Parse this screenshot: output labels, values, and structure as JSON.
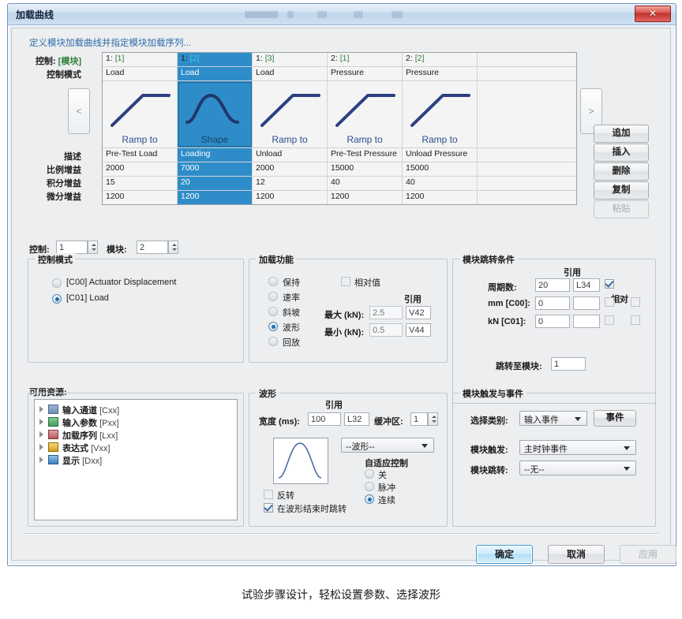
{
  "window": {
    "title": "加载曲线",
    "close_label": "✕",
    "subtitle": "定义模块加载曲线并指定模块加载序列..."
  },
  "sequence_table": {
    "row_labels": {
      "control": "控制:",
      "control_bracket": "[模块]",
      "control_mode": "控制模式",
      "description": "描述",
      "prop_gain": "比例增益",
      "int_gain": "积分增益",
      "diff_gain": "微分增益"
    },
    "prev_arrow": "<",
    "next_arrow": ">",
    "columns": [
      {
        "header_num": "1:",
        "header_idx": "[1]",
        "mode": "Load",
        "shape": "ramp",
        "shape_caption": "Ramp to",
        "description": "Pre-Test Load",
        "prop_gain": "2000",
        "int_gain": "15",
        "diff_gain": "1200",
        "selected": false
      },
      {
        "header_num": "1:",
        "header_idx": "[2]",
        "mode": "Load",
        "shape": "sine",
        "shape_caption": "Shape",
        "description": "Loading",
        "prop_gain": "7000",
        "int_gain": "20",
        "diff_gain": "1200",
        "selected": true
      },
      {
        "header_num": "1:",
        "header_idx": "[3]",
        "mode": "Load",
        "shape": "ramp",
        "shape_caption": "Ramp to",
        "description": "Unload",
        "prop_gain": "2000",
        "int_gain": "12",
        "diff_gain": "1200",
        "selected": false
      },
      {
        "header_num": "2:",
        "header_idx": "[1]",
        "mode": "Pressure",
        "shape": "ramp",
        "shape_caption": "Ramp to",
        "description": "Pre-Test Pressure",
        "prop_gain": "15000",
        "int_gain": "40",
        "diff_gain": "1200",
        "selected": false
      },
      {
        "header_num": "2:",
        "header_idx": "[2]",
        "mode": "Pressure",
        "shape": "ramp",
        "shape_caption": "Ramp to",
        "description": "Unload Pressure",
        "prop_gain": "15000",
        "int_gain": "40",
        "diff_gain": "1200",
        "selected": false
      },
      {
        "header_num": "",
        "header_idx": "",
        "mode": "",
        "shape": "none",
        "shape_caption": "",
        "description": "",
        "prop_gain": "",
        "int_gain": "",
        "diff_gain": "",
        "selected": false
      }
    ]
  },
  "side_buttons": [
    {
      "label": "追加",
      "enabled": true
    },
    {
      "label": "插入",
      "enabled": true
    },
    {
      "label": "删除",
      "enabled": true
    },
    {
      "label": "复制",
      "enabled": true
    },
    {
      "label": "粘贴",
      "enabled": false
    }
  ],
  "selectors": {
    "control_label": "控制:",
    "control_value": "1",
    "module_label": "模块:",
    "module_value": "2"
  },
  "control_mode": {
    "legend": "控制模式",
    "options": [
      {
        "label": "[C00] Actuator Displacement",
        "selected": false
      },
      {
        "label": "[C01] Load",
        "selected": true
      }
    ]
  },
  "load_function": {
    "legend": "加载功能",
    "options": [
      {
        "label": "保持",
        "selected": false
      },
      {
        "label": "速率",
        "selected": false
      },
      {
        "label": "斜坡",
        "selected": false
      },
      {
        "label": "波形",
        "selected": true
      },
      {
        "label": "回放",
        "selected": false
      }
    ],
    "relative_checkbox": {
      "label": "相对值",
      "checked": false
    },
    "reference_header": "引用",
    "max_label": "最大 (kN):",
    "max_value": "2.5",
    "max_ref": "V42",
    "min_label": "最小 (kN):",
    "min_value": "0.5",
    "min_ref": "V44"
  },
  "jump_conditions": {
    "legend": "模块跳转条件",
    "reference_header": "引用",
    "relative_header": "相对",
    "rows": [
      {
        "label": "周期数:",
        "value": "20",
        "ref": "L34",
        "ref_checked": true,
        "rel_checked": false,
        "enabled": true
      },
      {
        "label": "mm [C00]:",
        "value": "0",
        "ref": "",
        "ref_checked": false,
        "rel_checked": false,
        "enabled": false
      },
      {
        "label": "kN [C01]:",
        "value": "0",
        "ref": "",
        "ref_checked": false,
        "rel_checked": false,
        "enabled": false
      }
    ],
    "jump_to_label": "跳转至模块:",
    "jump_to_value": "1"
  },
  "resources": {
    "label": "可用资源:",
    "items": [
      {
        "name": "输入通道",
        "code": "[Cxx]",
        "icon": "channel-icon",
        "color": "#6c8fb5"
      },
      {
        "name": "输入参数",
        "code": "[Pxx]",
        "icon": "parameter-icon",
        "color": "#3f9e5a"
      },
      {
        "name": "加载序列",
        "code": "[Lxx]",
        "icon": "sequence-icon",
        "color": "#b5575e"
      },
      {
        "name": "表达式",
        "code": "[Vxx]",
        "icon": "expression-icon",
        "color": "#d4a017"
      },
      {
        "name": "显示",
        "code": "[Dxx]",
        "icon": "display-icon",
        "color": "#3f7fc1"
      }
    ]
  },
  "waveform": {
    "legend": "波形",
    "reference_header": "引用",
    "width_label": "宽度 (ms):",
    "width_value": "100",
    "width_ref": "L32",
    "buffer_label": "缓冲区:",
    "buffer_value": "1",
    "shape_select": "--波形--",
    "adaptive_legend": "自适应控制",
    "adaptive_options": [
      {
        "label": "关",
        "selected": false
      },
      {
        "label": "脉冲",
        "selected": false
      },
      {
        "label": "连续",
        "selected": true
      }
    ],
    "invert_checkbox": {
      "label": "反转",
      "checked": false
    },
    "jump_at_end_checkbox": {
      "label": "在波形结束时跳转",
      "checked": true
    }
  },
  "triggers": {
    "legend": "模块触发与事件",
    "category_label": "选择类别:",
    "category_value": "输入事件",
    "event_button": "事件",
    "module_trigger_label": "模块触发:",
    "module_trigger_value": "主时钟事件",
    "module_jump_label": "模块跳转:",
    "module_jump_value": "--无--"
  },
  "footer": {
    "ok": "确定",
    "cancel": "取消",
    "apply": "应用"
  },
  "caption": "试验步骤设计，轻松设置参数、选择波形"
}
